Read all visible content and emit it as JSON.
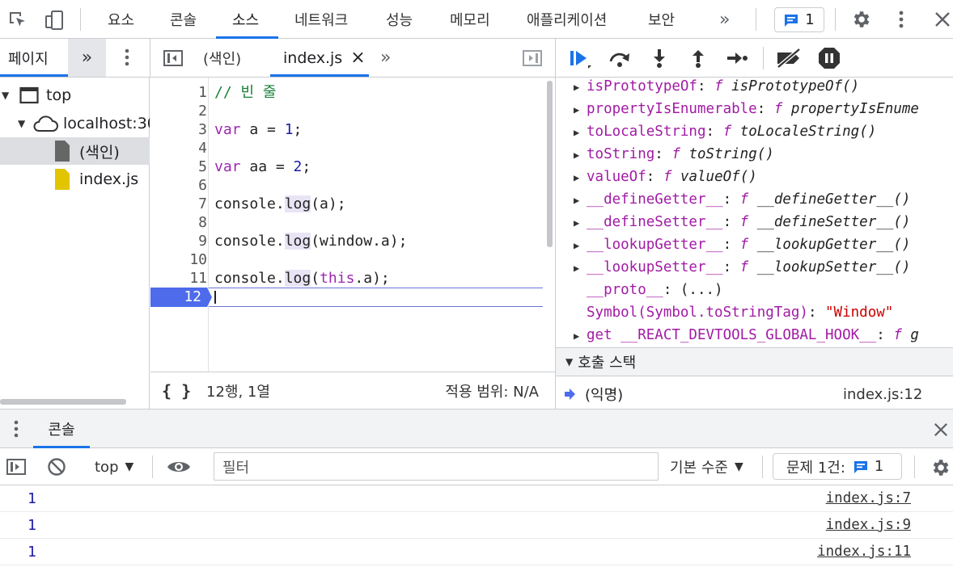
{
  "top_tabs": [
    "요소",
    "콘솔",
    "소스",
    "네트워크",
    "성능",
    "메모리",
    "애플리케이션",
    "보안"
  ],
  "top_more": "»",
  "issues_count": "1",
  "nav": {
    "tab_page": "페이지",
    "more": "»"
  },
  "tree": {
    "top": "top",
    "host": "localhost:30",
    "index_html": "(색인)",
    "index_js": "index.js"
  },
  "editor": {
    "tab_index": "(색인)",
    "tab_js": "index.js",
    "tab_close": "×",
    "more": "»",
    "lines": [
      "1",
      "2",
      "3",
      "4",
      "5",
      "6",
      "7",
      "8",
      "9",
      "10",
      "11",
      "12"
    ],
    "code": {
      "l1": "// 빈 줄",
      "var": "var",
      "a_eq": " a = ",
      "one": "1",
      "semi": ";",
      "aa_eq": " aa = ",
      "two": "2",
      "console": "console.",
      "log": "log",
      "arg1": "(a);",
      "arg2": "(window.a);",
      "paren": "(",
      "this": "this",
      "arg3": ".a);"
    },
    "status_braces": "{ }",
    "status_pos": "12행, 1열",
    "status_coverage": "적용 범위: N/A"
  },
  "scope": {
    "items": [
      {
        "key": "isPrototypeOf",
        "fn": "isPrototypeOf()"
      },
      {
        "key": "propertyIsEnumerable",
        "fn": "propertyIsEnume"
      },
      {
        "key": "toLocaleString",
        "fn": "toLocaleString()"
      },
      {
        "key": "toString",
        "fn": "toString()"
      },
      {
        "key": "valueOf",
        "fn": "valueOf()"
      },
      {
        "key": "__defineGetter__",
        "fn": "__defineGetter__()"
      },
      {
        "key": "__defineSetter__",
        "fn": "__defineSetter__()"
      },
      {
        "key": "__lookupGetter__",
        "fn": "__lookupGetter__()"
      },
      {
        "key": "__lookupSetter__",
        "fn": "__lookupSetter__()"
      }
    ],
    "f": "f",
    "colon": ": ",
    "proto_key": "__proto__",
    "proto_val": ": (...)",
    "symbol_key": "Symbol(Symbol.toStringTag)",
    "symbol_val": "\"Window\"",
    "hook_key": "get __REACT_DEVTOOLS_GLOBAL_HOOK__",
    "hook_val": "g",
    "callstack_title": "호출 스택",
    "frame_name": "(익명)",
    "frame_loc": "index.js:12"
  },
  "console": {
    "tab": "콘솔",
    "context": "top",
    "filter_placeholder": "필터",
    "levels": "기본 수준",
    "issues_label": "문제 1건:",
    "issues_count": "1",
    "rows": [
      {
        "value": "1",
        "link": "index.js:7"
      },
      {
        "value": "1",
        "link": "index.js:9"
      },
      {
        "value": "1",
        "link": "index.js:11"
      }
    ]
  },
  "colors": {
    "accent": "#1a73e8",
    "keyword": "#9c27b0",
    "number": "#1a1aa6",
    "comment": "#188038",
    "property": "#a11ba5",
    "string": "#c80000"
  }
}
